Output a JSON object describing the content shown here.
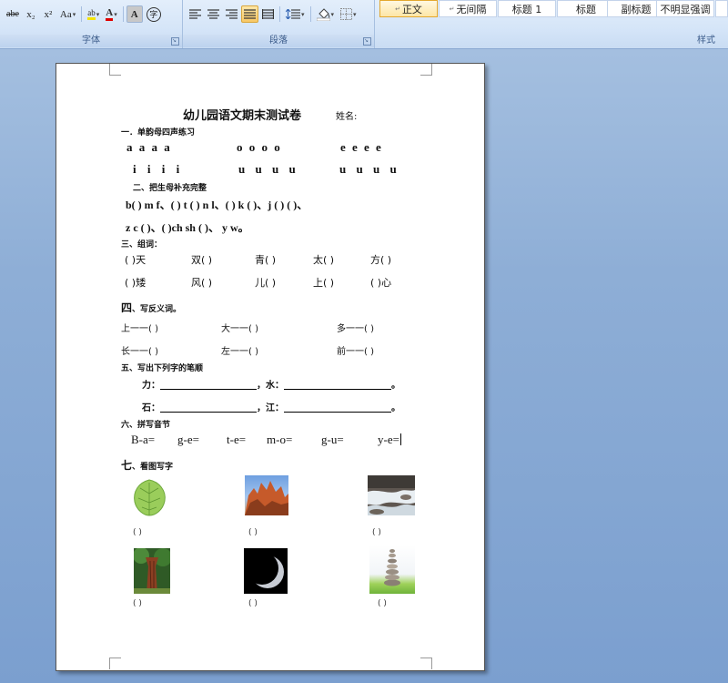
{
  "ribbon": {
    "font_group": {
      "label": "字体",
      "strike_label": "abe",
      "sub_label": "x₂",
      "sup_label": "x²",
      "case_label": "Aa",
      "highlight_label": "ab",
      "font_color_label": "A",
      "char_shading_label": "A",
      "enclose_label": "字"
    },
    "paragraph_group": {
      "label": "段落"
    },
    "styles_group": {
      "label": "样式",
      "items": [
        "正文",
        "无间隔",
        "标题 1",
        "标题",
        "副标题",
        "不明显强调"
      ],
      "marker": "↵"
    }
  },
  "document": {
    "title": "幼儿园语文期末测试卷",
    "name_label": "姓名:",
    "s1": {
      "heading": "一．单韵母四声练习",
      "row1": [
        "a a a a",
        "o o o o",
        "e e e e"
      ],
      "row2": [
        "i i i i",
        "u u u u",
        "u u u u"
      ]
    },
    "s2": {
      "heading": "二、把生母补充完整",
      "line1": "b(  ) m f、(  ) t (  ) n l、(  ) k (  )、j (  ) (  )、",
      "line2": "z  c (   )、(  )ch sh (  )、 y   w。"
    },
    "s3": {
      "heading": "三、组词：",
      "row1": [
        "(     )天",
        "双(     )",
        "青(     )",
        "太(     )",
        "方(     )"
      ],
      "row2": [
        "(     )矮",
        "风(     )",
        "儿(     )",
        "上(     )",
        "(     )心"
      ]
    },
    "s4": {
      "heading_big": "四",
      "heading_rest": "、写反义词。",
      "row1": [
        "上一一(     )",
        "大一一(     )",
        "多一一(     )"
      ],
      "row2": [
        "长一一(     )",
        "左一一(     )",
        "前一一(     )"
      ]
    },
    "s5": {
      "heading": "五、写出下列字的笔顺",
      "line1_a": "力：",
      "line1_b": "，水：",
      "line1_end": "。",
      "line2_a": "石：",
      "line2_b": "，江：",
      "line2_end": "。"
    },
    "s6": {
      "heading": "六、拼写音节",
      "items": [
        "B-a=",
        "g-e=",
        "t-e=",
        "m-o=",
        "g-u=",
        "y-e="
      ]
    },
    "s7": {
      "heading_big": "七",
      "heading_rest": "、看图写字",
      "caption": "(        )"
    }
  }
}
